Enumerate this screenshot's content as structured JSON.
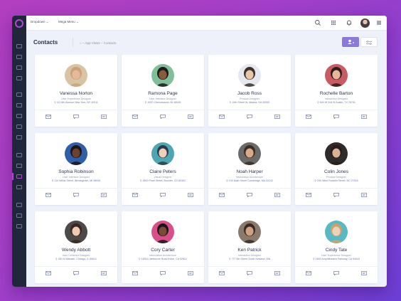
{
  "topbar": {
    "menu1": "Dropdown",
    "menu2": "Mega Menu"
  },
  "header": {
    "title": "Contacts",
    "breadcrumb": [
      "App Views",
      "Contacts"
    ]
  },
  "colors": {
    "accent": "#8b78d9",
    "sidebar": "#20273a",
    "brand": "#b04ad0"
  },
  "contacts": [
    {
      "name": "Vanessa Norton",
      "role": "User Experience Designer",
      "address": "111 8th Avenue New York, NY 10011",
      "skin": "#e7b99a",
      "hair": "#c9a27a",
      "bg": "#d8c3a5"
    },
    {
      "name": "Ramona Page",
      "role": "User Interface Designer",
      "address": "1000 Chennewood, MI 48026",
      "skin": "#8a5a3c",
      "hair": "#1e1a1a",
      "bg": "#7fbf9a"
    },
    {
      "name": "Jacob Ross",
      "role": "Product Designer",
      "address": "10th Street W, Atlanta, GA 30000",
      "skin": "#e8c6a8",
      "hair": "#3a2f2a",
      "bg": "#e5e8ee"
    },
    {
      "name": "Rochelle Barton",
      "role": "Interaction Designer",
      "address": "600 W 2nd St Austin, TX 78701",
      "skin": "#e6b79a",
      "hair": "#2e1d1a",
      "bg": "#c95a63"
    },
    {
      "name": "Sophia Robinson",
      "role": "User Interface Designer",
      "address": "114 Willits Street, Birmingham, MI 48009",
      "skin": "#6b4230",
      "hair": "#1c1414",
      "bg": "#2f5fa8"
    },
    {
      "name": "Claire Peters",
      "role": "Visual Designer",
      "address": "2600 Pearl Street, Boulder, CO 80302",
      "skin": "#f0cfb8",
      "hair": "#2b3b4a",
      "bg": "#4fa6b3"
    },
    {
      "name": "Noah Harper",
      "role": "Information Architecture",
      "address": "100 Main Street Cambridge, MA 02142",
      "skin": "#d9a98a",
      "hair": "#3b2c24",
      "bg": "#6a6a6a"
    },
    {
      "name": "Colin Jones",
      "role": "Product Designer",
      "address": "200 West Franklin Street, NC 27516",
      "skin": "#d9b193",
      "hair": "#2a1c17",
      "bg": "#2f2b2b"
    },
    {
      "name": "Wendy Abbott",
      "role": "User Centered Designer",
      "address": "330 N Wabash, Chicago, IL 60611",
      "skin": "#f1c9ae",
      "hair": "#3a2520",
      "bg": "#4b4a48"
    },
    {
      "name": "Cory Carter",
      "role": "Information Architecture",
      "address": "18010 Jamboree Road Irvine, CA 92612",
      "skin": "#7a4a32",
      "hair": "#1a1616",
      "bg": "#d94f8a"
    },
    {
      "name": "Ken Patrick",
      "role": "Interaction Designer",
      "address": "777 6th Street South Kirkland, WA",
      "skin": "#cfa184",
      "hair": "#3c2a22",
      "bg": "#8a7a6c"
    },
    {
      "name": "Cindy Tate",
      "role": "User Experience Designer",
      "address": "1600 Amphitheatre Parkway, CA 94043",
      "skin": "#f0d0b8",
      "hair": "#c9a46c",
      "bg": "#58b9c6"
    }
  ]
}
